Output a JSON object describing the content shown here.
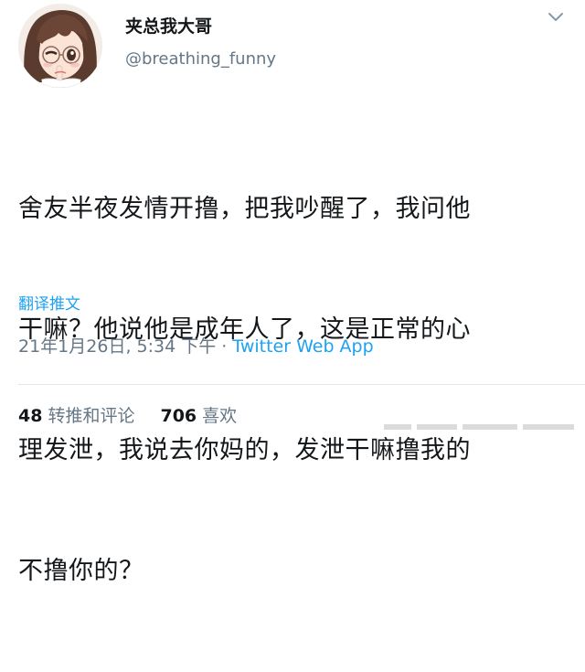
{
  "author": {
    "display_name": "夹总我大哥",
    "handle": "@breathing_funny"
  },
  "tweet": {
    "lines": [
      "舍友半夜发情开撸，把我吵醒了，我问他",
      "干嘛？他说他是成年人了，这是正常的心",
      "理发泄，我说去你妈的，发泄干嘛撸我的",
      "不撸你的？"
    ]
  },
  "translate_label": "翻译推文",
  "meta": {
    "timestamp": "21年1月26日, 5:34 下午",
    "separator": " · ",
    "source": "Twitter Web App"
  },
  "stats": {
    "retweets_count": "48",
    "retweets_label": "转推和评论",
    "likes_count": "706",
    "likes_label": "喜欢"
  },
  "icons": {
    "avatar": "anime-girl-avatar",
    "menu": "chevron-down-icon"
  },
  "colors": {
    "link_blue": "#1da1f2",
    "muted_gray": "#657786",
    "text_dark": "#14171a"
  }
}
